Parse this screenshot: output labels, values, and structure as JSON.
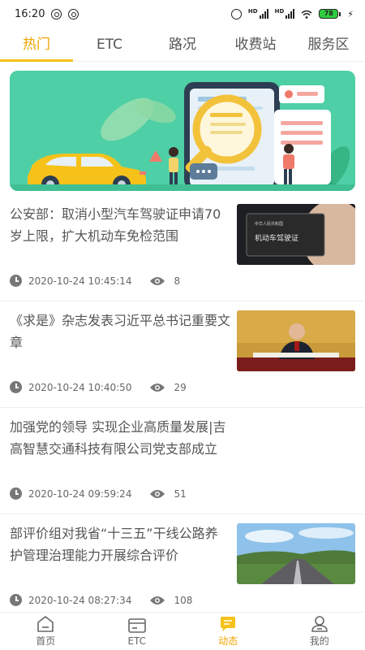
{
  "status_bar": {
    "time": "16:20",
    "signal_label_1": "HD",
    "signal_label_2": "HD",
    "battery": "78"
  },
  "tabs": [
    {
      "label": "热门",
      "active": true
    },
    {
      "label": "ETC",
      "active": false
    },
    {
      "label": "路况",
      "active": false
    },
    {
      "label": "收费站",
      "active": false
    },
    {
      "label": "服务区",
      "active": false
    }
  ],
  "news": [
    {
      "title": "公安部：取消小型汽车驾驶证申请70岁上限，扩大机动车免检范围",
      "time": "2020-10-24 10:45:14",
      "views": "8",
      "thumb": "license-card",
      "thumb_text": "机动车驾驶证",
      "thumb_small": "中华人民共和国"
    },
    {
      "title": "《求是》杂志发表习近平总书记重要文章",
      "time": "2020-10-24 10:40:50",
      "views": "29",
      "thumb": "speaker-photo"
    },
    {
      "title": "加强党的领导 实现企业高质量发展|吉高智慧交通科技有限公司党支部成立",
      "time": "2020-10-24 09:59:24",
      "views": "51",
      "thumb": ""
    },
    {
      "title": "部评价组对我省“十三五”干线公路养护管理治理能力开展综合评价",
      "time": "2020-10-24 08:27:34",
      "views": "108",
      "thumb": "highway-photo"
    }
  ],
  "bottom_nav": [
    {
      "label": "首页",
      "icon": "home-icon",
      "active": false
    },
    {
      "label": "ETC",
      "icon": "etc-card-icon",
      "active": false
    },
    {
      "label": "动态",
      "icon": "news-chat-icon",
      "active": true
    },
    {
      "label": "我的",
      "icon": "user-icon",
      "active": false
    }
  ],
  "colors": {
    "accent": "#f0a500",
    "banner_bg": "#4fcfa6"
  }
}
